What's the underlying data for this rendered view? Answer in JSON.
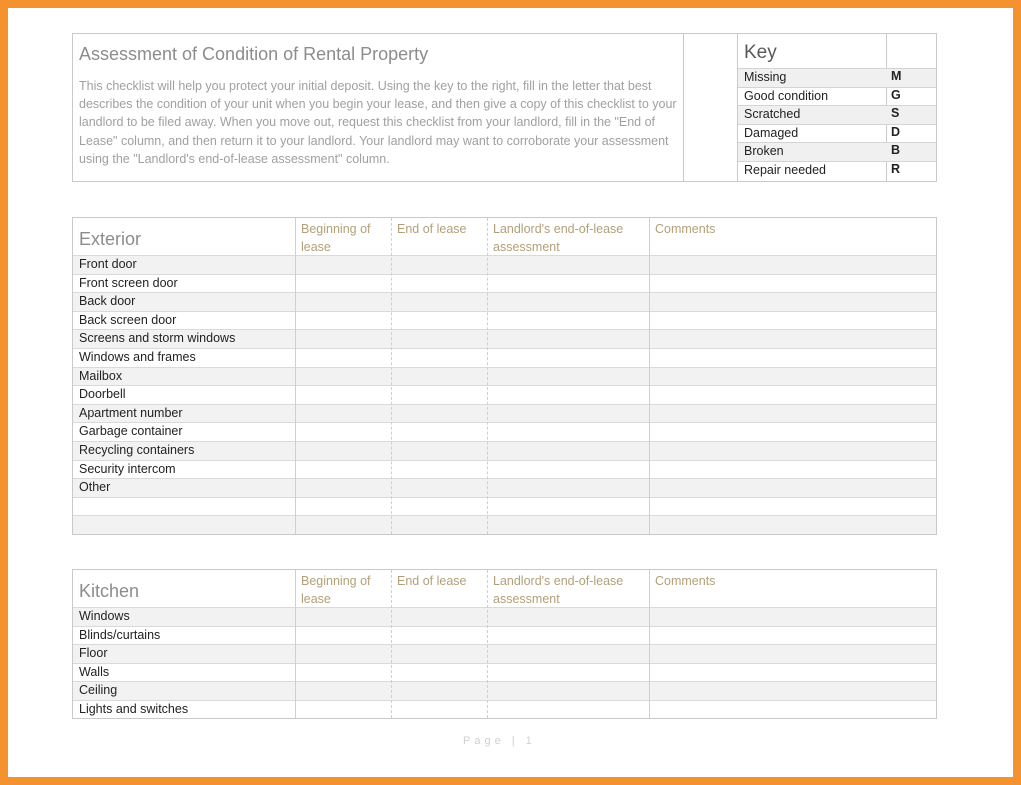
{
  "intro": {
    "title": "Assessment  of Condition of Rental Property",
    "text": "This checklist will help you protect your initial deposit. Using the key to the right, fill in the letter that best describes the condition of your unit when you begin your lease, and then give a copy of this checklist to your landlord to be filed away. When you move out, request this checklist from your landlord, fill in the \"End of Lease\" column, and then return it to your landlord. Your landlord may want to corroborate your assessment using the \"Landlord's end-of-lease assessment\" column."
  },
  "key": {
    "title": "Key",
    "rows": [
      {
        "label": "Missing",
        "code": "M"
      },
      {
        "label": "Good condition",
        "code": "G"
      },
      {
        "label": "Scratched",
        "code": "S"
      },
      {
        "label": "Damaged",
        "code": "D"
      },
      {
        "label": "Broken",
        "code": "B"
      },
      {
        "label": "Repair needed",
        "code": "R"
      }
    ]
  },
  "columns": {
    "beginning": "Beginning of lease",
    "end": "End of lease",
    "landlord": "Landlord's end-of-lease assessment",
    "comments": "Comments"
  },
  "exterior": {
    "title": "Exterior",
    "items": [
      "Front door",
      "Front screen door",
      "Back door",
      "Back screen door",
      "Screens and storm windows",
      "Windows and frames",
      "Mailbox",
      "Doorbell",
      "Apartment number",
      "Garbage container",
      "Recycling containers",
      "Security intercom",
      "Other",
      "",
      ""
    ]
  },
  "kitchen": {
    "title": "Kitchen",
    "items": [
      "Windows",
      "Blinds/curtains",
      "Floor",
      "Walls",
      "Ceiling",
      "Lights and switches"
    ]
  },
  "footer": {
    "page_text": "Page | 1"
  }
}
